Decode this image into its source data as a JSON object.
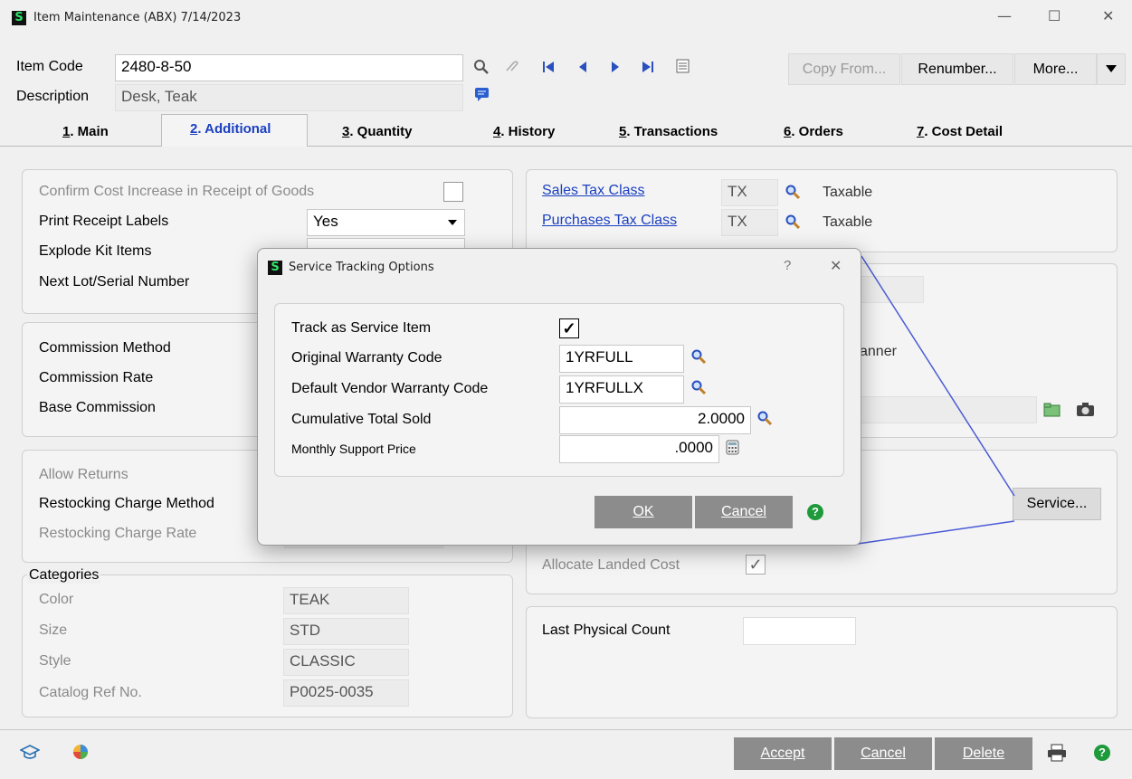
{
  "window": {
    "title": "Item Maintenance (ABX) 7/14/2023",
    "app_icon": "S"
  },
  "header": {
    "item_code_label": "Item Code",
    "item_code_value": "2480-8-50",
    "description_label": "Description",
    "description_value": "Desk, Teak",
    "copy_from": "Copy From...",
    "renumber": "Renumber...",
    "more": "More..."
  },
  "tabs": [
    {
      "num": "1",
      "label": ". Main"
    },
    {
      "num": "2",
      "label": ". Additional"
    },
    {
      "num": "3",
      "label": ". Quantity"
    },
    {
      "num": "4",
      "label": ". History"
    },
    {
      "num": "5",
      "label": ". Transactions"
    },
    {
      "num": "6",
      "label": ". Orders"
    },
    {
      "num": "7",
      "label": ". Cost Detail"
    }
  ],
  "left": {
    "confirm_cost": "Confirm Cost Increase in Receipt of Goods",
    "print_receipt_labels": "Print Receipt Labels",
    "print_receipt_value": "Yes",
    "explode_kit": "Explode Kit Items",
    "next_lot": "Next Lot/Serial Number",
    "commission_method": "Commission Method",
    "commission_rate": "Commission Rate",
    "base_commission": "Base Commission",
    "allow_returns": "Allow Returns",
    "restocking_method": "Restocking Charge Method",
    "restocking_rate": "Restocking Charge Rate"
  },
  "categories": {
    "title": "Categories",
    "rows": [
      {
        "label": "Color",
        "value": "TEAK"
      },
      {
        "label": "Size",
        "value": "STD"
      },
      {
        "label": "Style",
        "value": "CLASSIC"
      },
      {
        "label": "Catalog Ref No.",
        "value": "P0025-0035"
      }
    ]
  },
  "right": {
    "sales_tax_class": "Sales Tax Class",
    "sales_tax_value": "TX",
    "sales_tax_desc": "Taxable",
    "purchases_tax_class": "Purchases Tax Class",
    "purchases_tax_value": "TX",
    "purchases_tax_desc": "Taxable",
    "partial_text": "anner",
    "service_button": "Service...",
    "allocate_landed_cost": "Allocate Landed Cost",
    "last_physical_count": "Last Physical Count"
  },
  "dialog": {
    "title": "Service Tracking Options",
    "help_q": "?",
    "close": "✕",
    "track_label": "Track as Service Item",
    "warranty_label": "Original Warranty Code",
    "warranty_value": "1YRFULL",
    "vendor_label": "Default Vendor Warranty Code",
    "vendor_value": "1YRFULLX",
    "cumulative_label": "Cumulative Total Sold",
    "cumulative_value": "2.0000",
    "support_label": "Monthly Support Price",
    "support_value": ".0000",
    "ok": "OK",
    "cancel": "Cancel"
  },
  "footer": {
    "accept": "Accept",
    "cancel": "Cancel",
    "delete": "Delete"
  }
}
